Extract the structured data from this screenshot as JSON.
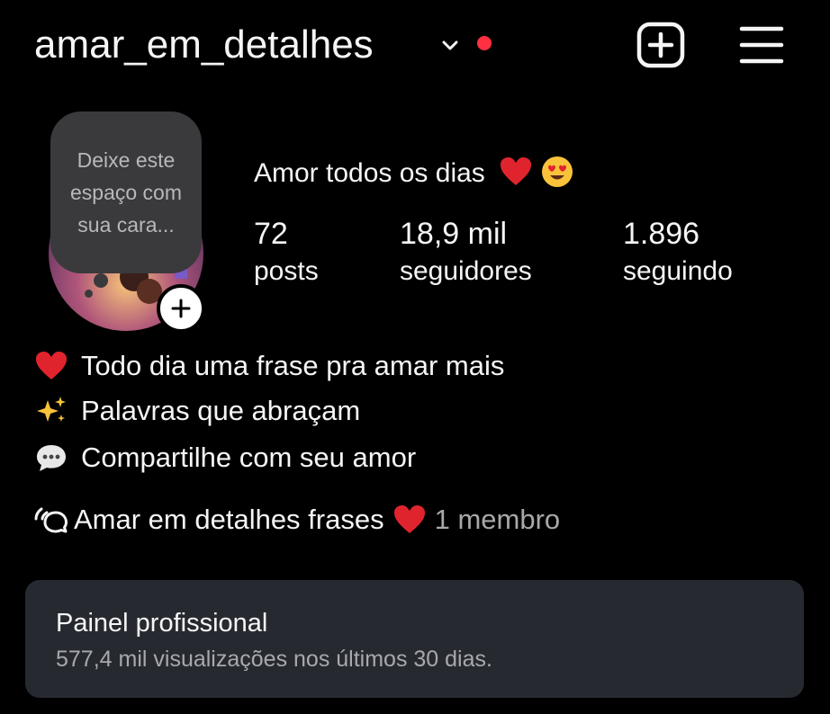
{
  "header": {
    "username": "amar_em_detalhes",
    "icons": [
      "chevron-down-icon",
      "notification-dot",
      "add-square-icon",
      "hamburger-menu-icon"
    ],
    "accent_dot_color": "#ff3040"
  },
  "profile": {
    "note_text": "Deixe este espaço com sua cara...",
    "display_name": "Amor todos os dias",
    "stats": [
      {
        "value": "72",
        "label": "posts"
      },
      {
        "value": "18,9 mil",
        "label": "seguidores"
      },
      {
        "value": "1.896",
        "label": "seguindo"
      }
    ]
  },
  "bio": [
    {
      "icon": "red-heart-emoji",
      "text": "Todo dia uma frase pra amar mais"
    },
    {
      "icon": "sparkles-emoji",
      "text": "Palavras que abraçam"
    },
    {
      "icon": "speech-balloon-emoji",
      "text": "Compartilhe com seu amor"
    }
  ],
  "channel": {
    "icon": "broadcast-channel-icon",
    "name": "Amar em detalhes frases",
    "members": "1 membro"
  },
  "dashboard": {
    "title": "Painel profissional",
    "subtitle": "577,4 mil visualizações nos últimos 30 dias."
  }
}
